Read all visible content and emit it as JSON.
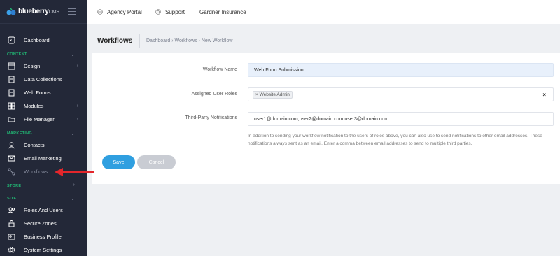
{
  "brand": {
    "name": "blueberry",
    "suffix": "CMS"
  },
  "topbar": {
    "links": [
      {
        "label": "Agency Portal",
        "icon": "globe-icon"
      },
      {
        "label": "Support",
        "icon": "lifebuoy-icon"
      },
      {
        "label": "Gardner Insurance"
      }
    ]
  },
  "sidebar": {
    "dashboard": "Dashboard",
    "sections": {
      "content": "CONTENT",
      "marketing": "MARKETING",
      "store": "STORE",
      "site": "SITE"
    },
    "items": {
      "design": "Design",
      "data_collections": "Data Collections",
      "web_forms": "Web Forms",
      "modules": "Modules",
      "file_manager": "File Manager",
      "contacts": "Contacts",
      "email_marketing": "Email Marketing",
      "workflows": "Workflows",
      "roles_and_users": "Roles And Users",
      "secure_zones": "Secure Zones",
      "business_profile": "Business Profile",
      "system_settings": "System Settings"
    }
  },
  "page": {
    "title": "Workflows",
    "breadcrumb": "Dashboard  ›  Workflows  ›  New Workflow"
  },
  "form": {
    "workflow_name_label": "Workflow Name",
    "workflow_name_value": "Web Form Submission",
    "roles_label": "Assigned User Roles",
    "roles_tag": "Website Admin",
    "roles_tag_remove": "×",
    "roles_clear": "×",
    "notifications_label": "Third-Party Notifications",
    "notifications_value": "user1@domain.com,user2@domain.com,user3@domain.com",
    "help_text": "In addition to sending your workflow notification to the users of roles above, you can also use to send notifications to other email addresses. These notifications always sent as an email. Enter a comma between email addresses to send to multiple third parties."
  },
  "buttons": {
    "save": "Save",
    "cancel": "Cancel"
  },
  "colors": {
    "sidebar_bg": "#232838",
    "section": "#21b573",
    "save": "#2f9fe0",
    "arrow": "#e3262b"
  }
}
